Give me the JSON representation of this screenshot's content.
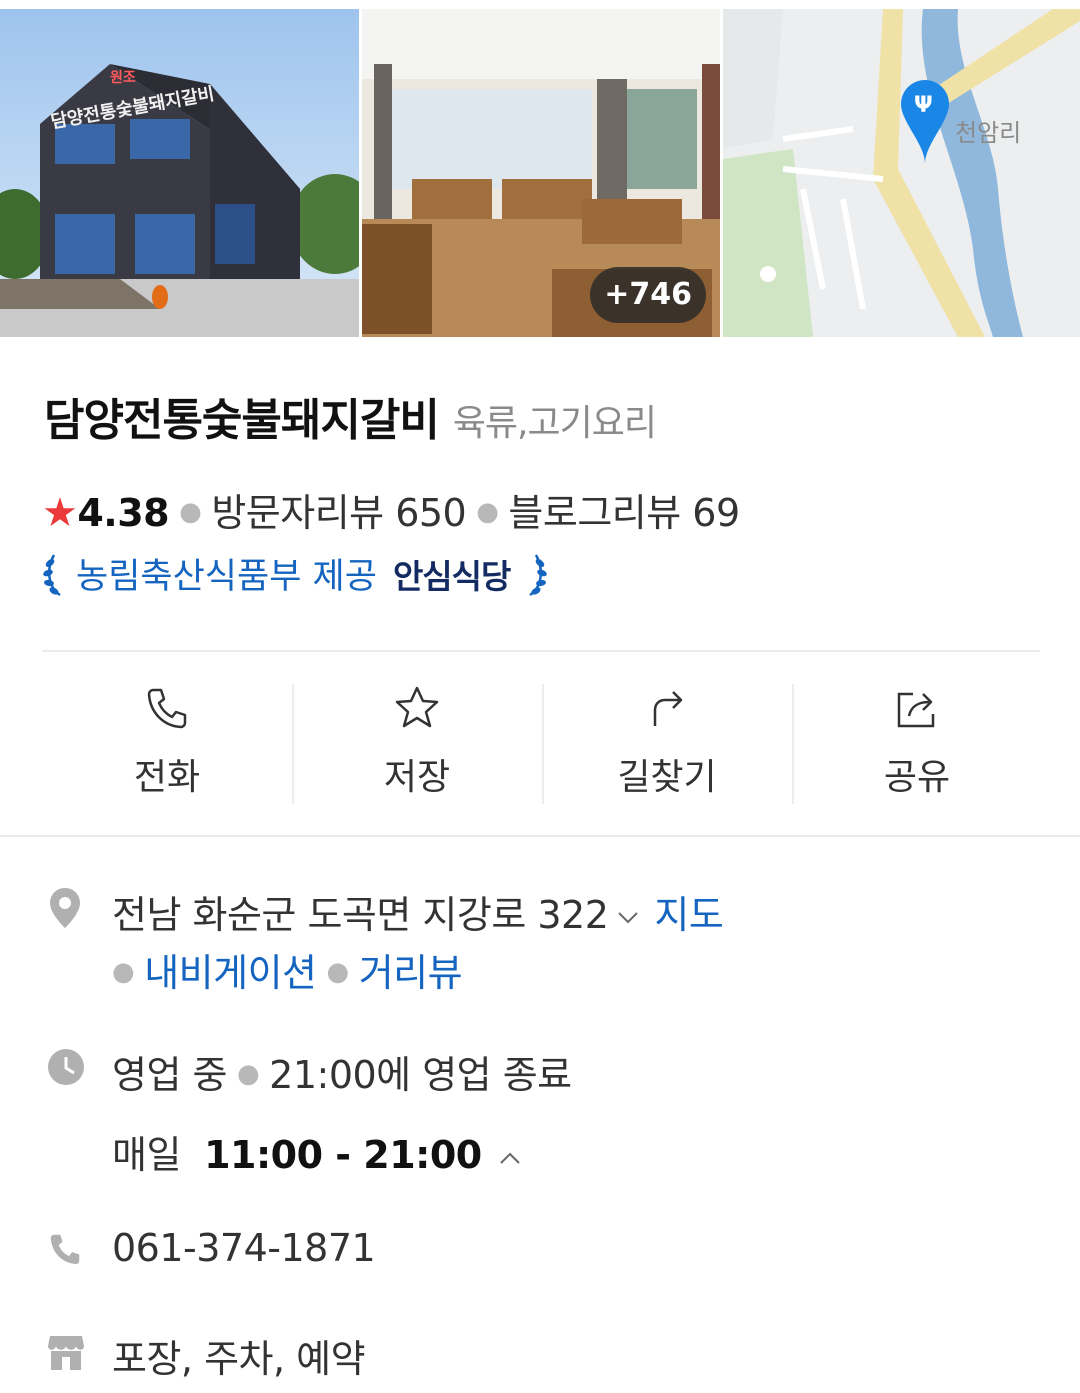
{
  "photos": {
    "exterior_sign_top": "원조",
    "exterior_sign_main": "담양전통숯불돼지갈비",
    "more_count": "+746",
    "map_place_label": "천암리"
  },
  "place": {
    "name": "담양전통숯불돼지갈비",
    "category": "육류,고기요리",
    "rating": "4.38",
    "visitor_reviews": "방문자리뷰 650",
    "blog_reviews": "블로그리뷰 69",
    "certification_provider": "농림축산식품부 제공",
    "certification_badge": "안심식당"
  },
  "actions": [
    {
      "label": "전화",
      "icon": "phone-icon"
    },
    {
      "label": "저장",
      "icon": "star-icon"
    },
    {
      "label": "길찾기",
      "icon": "directions-icon"
    },
    {
      "label": "공유",
      "icon": "share-icon"
    }
  ],
  "address": {
    "text": "전남 화순군 도곡면 지강로 322",
    "map_link": "지도",
    "navigation_link": "내비게이션",
    "streetview_link": "거리뷰"
  },
  "hours": {
    "status": "영업 중",
    "closing": "21:00에 영업 종료",
    "days": "매일",
    "range": "11:00 - 21:00"
  },
  "phone": "061-374-1871",
  "amenities": "포장, 주차, 예약",
  "colors": {
    "link": "#1565c0",
    "star": "#ec3a3a",
    "icon_gray": "#9e9e9e"
  }
}
